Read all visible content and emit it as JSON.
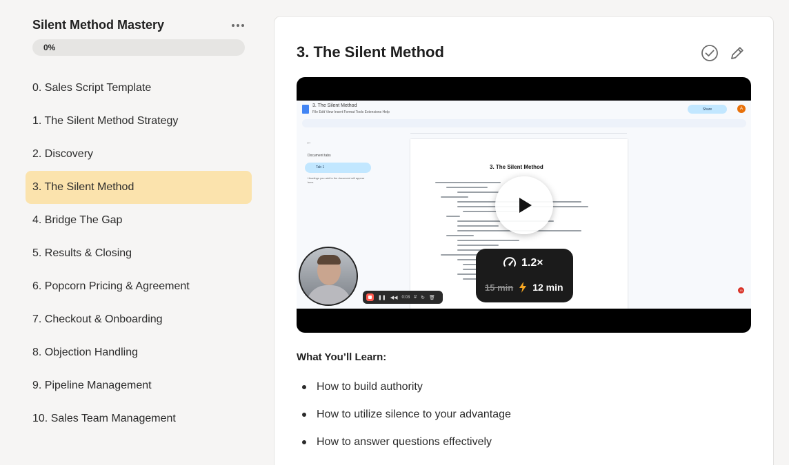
{
  "sidebar": {
    "course_title": "Silent Method Mastery",
    "progress_label": "0%",
    "progress_fraction": 0,
    "items": [
      {
        "label": "0. Sales Script Template"
      },
      {
        "label": "1. The Silent Method Strategy"
      },
      {
        "label": "2. Discovery"
      },
      {
        "label": "3. The Silent Method",
        "active": true
      },
      {
        "label": "4. Bridge The Gap"
      },
      {
        "label": "5. Results & Closing"
      },
      {
        "label": "6. Popcorn Pricing & Agreement"
      },
      {
        "label": "7. Checkout & Onboarding"
      },
      {
        "label": "8. Objection Handling"
      },
      {
        "label": "9. Pipeline Management"
      },
      {
        "label": "10. Sales Team Management"
      }
    ]
  },
  "lesson": {
    "title": "3. The Silent Method",
    "complete_icon": "check-circle-icon",
    "edit_icon": "pencil-icon"
  },
  "video": {
    "document_name": "3. The Silent Method",
    "document_menu": "File  Edit  View  Insert  Format  Tools  Extensions  Help",
    "share_label": "Share",
    "avatar_letter": "A",
    "document_tabs_title": "Document tabs",
    "tab_label": "Tab 1",
    "tab_note": "Headings you add to the document will appear here.",
    "doc_heading": "3. The Silent Method",
    "recorder_time": "0:03",
    "notification_count": "15",
    "speed_label": "1.2×",
    "original_time": "15 min",
    "adjusted_time": "12 min",
    "play_icon": "play-icon",
    "speed_icon": "speed-gauge-icon",
    "lightning_icon": "lightning-icon"
  },
  "learn": {
    "heading": "What You’ll Learn:",
    "items": [
      "How to build authority",
      "How to utilize silence to your advantage",
      "How to answer questions effectively"
    ]
  },
  "colors": {
    "active_item": "#fbe3ad",
    "page_background": "#f6f5f4",
    "card_background": "#ffffff",
    "accent_orange": "#f5a623"
  }
}
